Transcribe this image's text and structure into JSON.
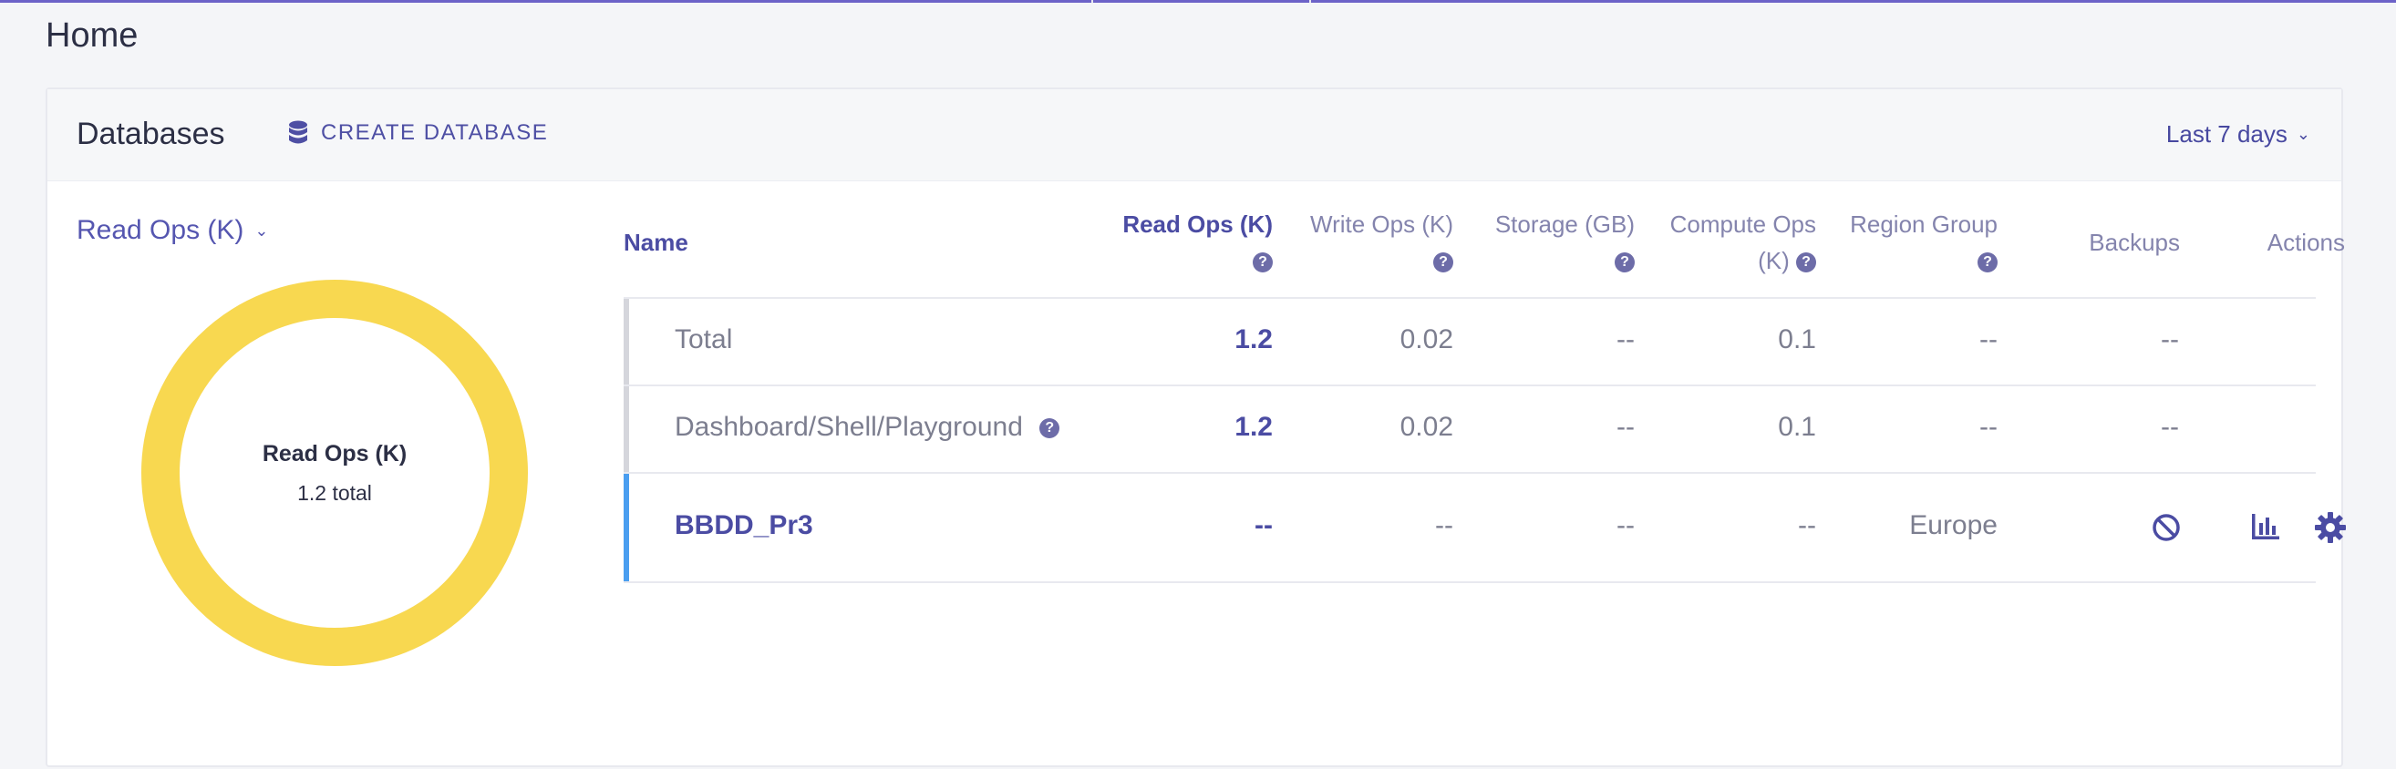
{
  "page": {
    "title": "Home"
  },
  "card": {
    "title": "Databases",
    "create_label": "CREATE DATABASE",
    "range_label": "Last 7 days"
  },
  "metric": {
    "selected": "Read Ops (K)",
    "donut_title": "Read Ops (K)",
    "donut_sub": "1.2 total",
    "donut_color": "#f8d850",
    "donut_share": 1.0
  },
  "table": {
    "columns": {
      "name": "Name",
      "read_ops": "Read Ops (K)",
      "write_ops": "Write Ops (K)",
      "storage": "Storage (GB)",
      "compute_line1": "Compute Ops",
      "compute_line2": "(K)",
      "region": "Region Group",
      "backups": "Backups",
      "actions": "Actions"
    },
    "help_glyph": "?",
    "rows": [
      {
        "name": "Total",
        "read_ops": "1.2",
        "write_ops": "0.02",
        "storage": "--",
        "compute": "0.1",
        "region": "--",
        "backups": "--"
      },
      {
        "name": "Dashboard/Shell/Playground",
        "read_ops": "1.2",
        "write_ops": "0.02",
        "storage": "--",
        "compute": "0.1",
        "region": "--",
        "backups": "--"
      },
      {
        "name": "BBDD_Pr3",
        "read_ops": "--",
        "write_ops": "--",
        "storage": "--",
        "compute": "--",
        "region": "Europe",
        "backups_icon": "disabled-icon",
        "action_icons": [
          "bar-chart-icon",
          "gear-icon"
        ]
      }
    ]
  },
  "colors": {
    "accent": "#4b4ca3",
    "selected_row_bar": "#4a9ef0",
    "summary_row_bar": "#d5d6dc"
  }
}
